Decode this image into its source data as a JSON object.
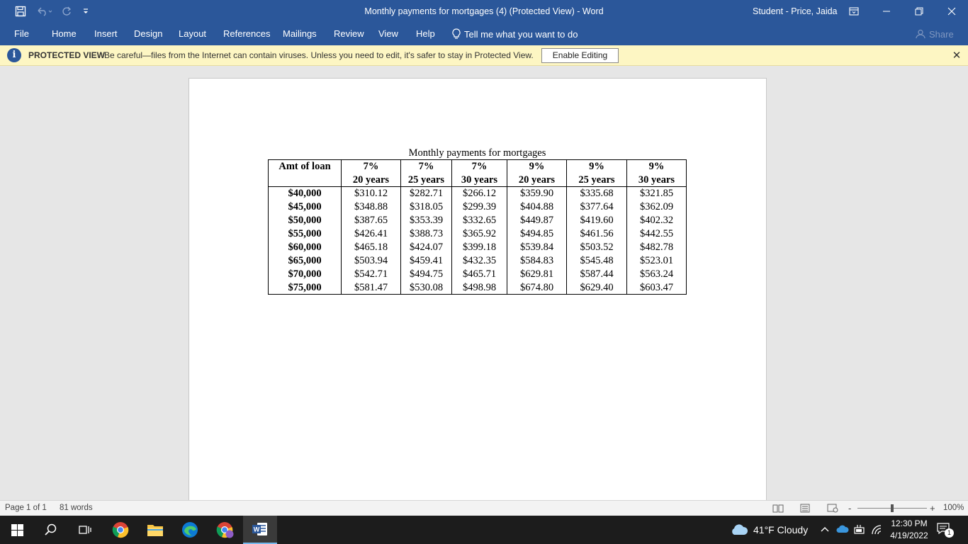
{
  "window": {
    "title": "Monthly payments for mortgages (4) (Protected View)  -  Word",
    "user": "Student - Price, Jaida"
  },
  "ribbon": {
    "tabs": [
      "File",
      "Home",
      "Insert",
      "Design",
      "Layout",
      "References",
      "Mailings",
      "Review",
      "View",
      "Help"
    ],
    "tell_me": "Tell me what you want to do",
    "share": "Share"
  },
  "protected_view": {
    "label": "PROTECTED VIEW",
    "message": "Be careful—files from the Internet can contain viruses. Unless you need to edit, it's safer to stay in Protected View.",
    "enable_button": "Enable Editing",
    "close_symbol": "✕"
  },
  "document": {
    "caption": "Monthly payments for mortgages",
    "header_row1": [
      "Amt of loan",
      "7%",
      "7%",
      "7%",
      "9%",
      "9%",
      "9%"
    ],
    "header_row2": [
      "",
      "20 years",
      "25 years",
      "30 years",
      "20 years",
      "25 years",
      "30 years"
    ],
    "rows": [
      [
        "$40,000",
        "$310.12",
        "$282.71",
        "$266.12",
        "$359.90",
        "$335.68",
        "$321.85"
      ],
      [
        "$45,000",
        "$348.88",
        "$318.05",
        "$299.39",
        "$404.88",
        "$377.64",
        "$362.09"
      ],
      [
        "$50,000",
        "$387.65",
        "$353.39",
        "$332.65",
        "$449.87",
        "$419.60",
        "$402.32"
      ],
      [
        "$55,000",
        "$426.41",
        "$388.73",
        "$365.92",
        "$494.85",
        "$461.56",
        "$442.55"
      ],
      [
        "$60,000",
        "$465.18",
        "$424.07",
        "$399.18",
        "$539.84",
        "$503.52",
        "$482.78"
      ],
      [
        "$65,000",
        "$503.94",
        "$459.41",
        "$432.35",
        "$584.83",
        "$545.48",
        "$523.01"
      ],
      [
        "$70,000",
        "$542.71",
        "$494.75",
        "$465.71",
        "$629.81",
        "$587.44",
        "$563.24"
      ],
      [
        "$75,000",
        "$581.47",
        "$530.08",
        "$498.98",
        "$674.80",
        "$629.40",
        "$603.47"
      ]
    ]
  },
  "status": {
    "page": "Page 1 of 1",
    "words": "81 words",
    "zoom": "100%",
    "zoom_minus": "-",
    "zoom_plus": "+"
  },
  "taskbar": {
    "weather": "41°F  Cloudy",
    "time": "12:30 PM",
    "date": "4/19/2022",
    "notifications": "1"
  },
  "colors": {
    "word_blue": "#2b579a",
    "protected_bar": "#fdf6c3",
    "taskbar": "#1c1c1c"
  }
}
